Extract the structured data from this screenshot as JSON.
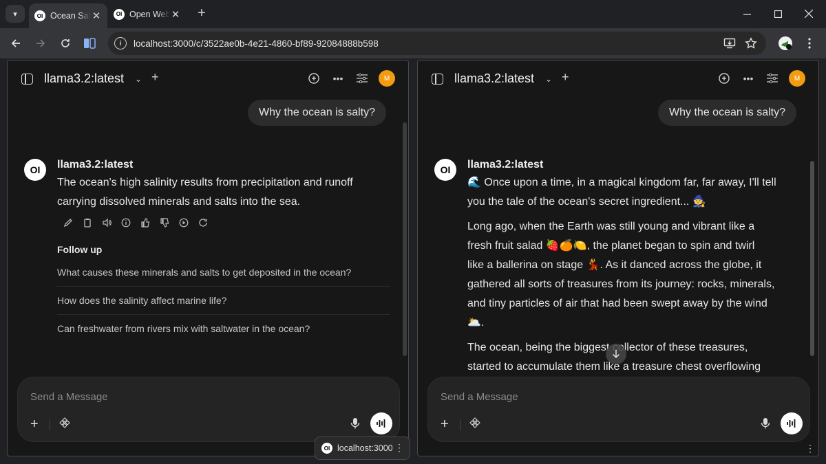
{
  "browser": {
    "tabs": [
      {
        "favicon": "OI",
        "title": "Ocean Salty"
      },
      {
        "favicon": "OI",
        "title": "Open WebUI"
      }
    ],
    "close_glyph": "✕",
    "new_tab_glyph": "+",
    "url": "localhost:3000/c/3522ae0b-4e21-4860-bf89-92084888b598",
    "status_host": "localhost:3000"
  },
  "panes": [
    {
      "model_name": "llama3.2:latest",
      "user_message": "Why the ocean is salty?",
      "assistant_name": "llama3.2:latest",
      "assistant_avatar": "OI",
      "user_avatar": "M",
      "response_lines": [
        "The ocean's high salinity results from precipitation and runoff",
        "carrying dissolved minerals and salts into the sea."
      ],
      "followup_title": "Follow up",
      "followups": [
        "What causes these minerals and salts to get deposited in the ocean?",
        "How does the salinity affect marine life?",
        "Can freshwater from rivers mix with saltwater in the ocean?"
      ],
      "input_placeholder": "Send a Message"
    },
    {
      "model_name": "llama3.2:latest",
      "user_message": "Why the ocean is salty?",
      "assistant_name": "llama3.2:latest",
      "assistant_avatar": "OI",
      "user_avatar": "M",
      "paragraphs": [
        [
          "🌊 Once upon a time, in a magical kingdom far, far away, I'll tell",
          "you the tale of the ocean's secret ingredient... 🧙"
        ],
        [
          "Long ago, when the Earth was still young and vibrant like a",
          "fresh fruit salad 🍓🍊🍋, the planet began to spin and twirl",
          "like a ballerina on stage 💃. As it danced across the globe, it",
          "gathered all sorts of treasures from its journey: rocks, minerals,",
          "and tiny particles of air that had been swept away by the wind",
          "🌥️."
        ],
        [
          "The ocean, being the biggest collector of these treasures,",
          "started to accumulate them like a treasure chest overflowing"
        ]
      ],
      "input_placeholder": "Send a Message"
    }
  ],
  "colors": {
    "accent_avatar": "#f39c12",
    "pane_bg": "#171717",
    "chrome_bg": "#202124"
  }
}
